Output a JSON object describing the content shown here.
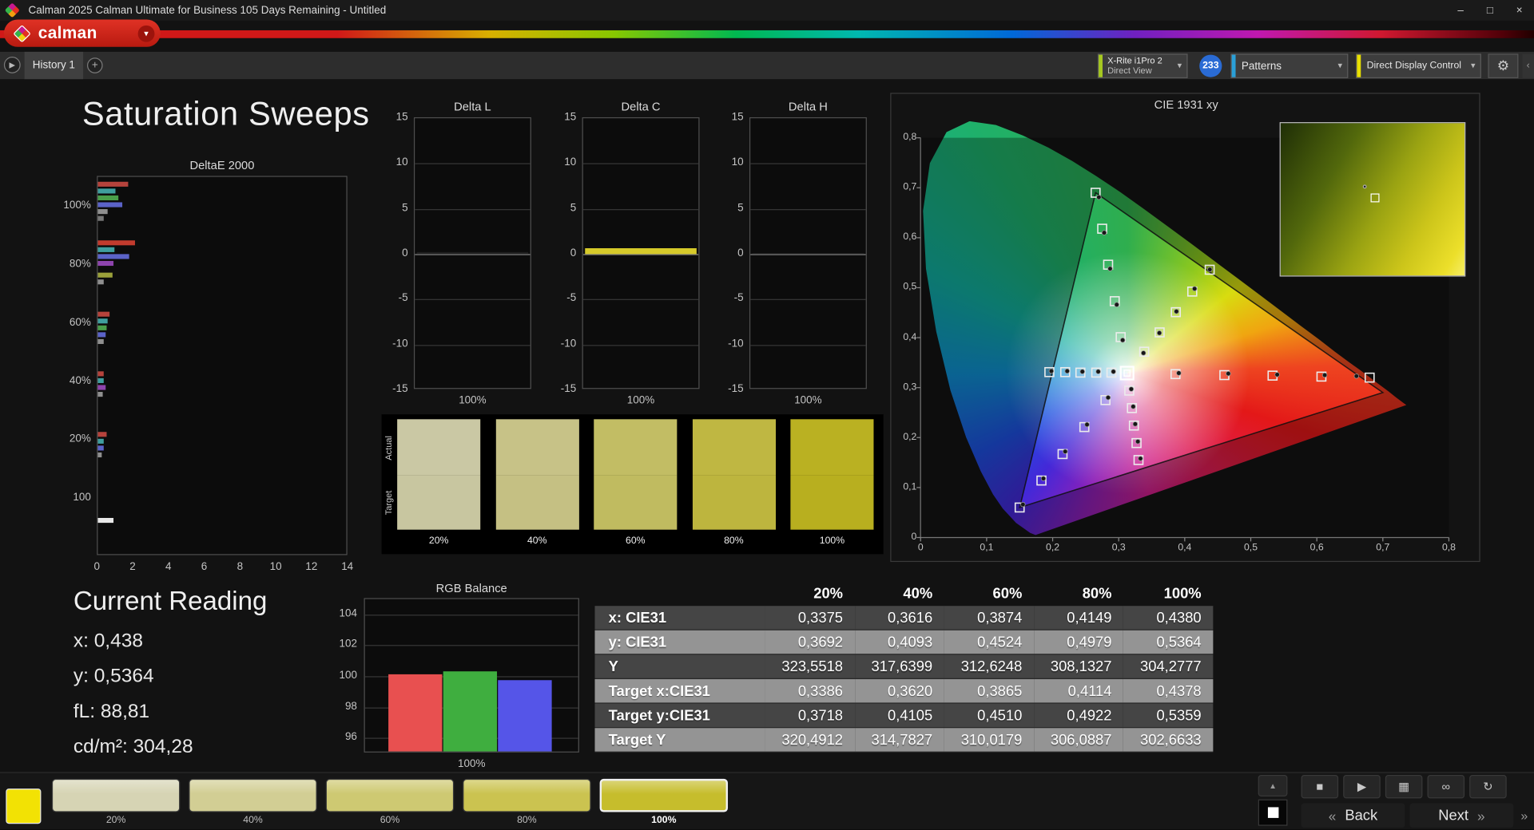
{
  "window": {
    "title": "Calman 2025 Calman Ultimate for Business 105 Days Remaining  - Untitled",
    "minimize_glyph": "–",
    "maximize_glyph": "□",
    "close_glyph": "×"
  },
  "brand": {
    "wordmark": "calman",
    "caret_glyph": "▾"
  },
  "nav": {
    "history_tab": "History 1",
    "add_tab_glyph": "+",
    "back_glyph": "▶"
  },
  "device_bar": {
    "meter_name": "X-Rite i1Pro 2",
    "meter_mode": "Direct View",
    "meter_accent": "#a6c821",
    "meter_badge": "233",
    "badge_color": "#2a6bd4",
    "patterns_label": "Patterns",
    "patterns_accent": "#2aa0d8",
    "display_control_label": "Direct Display Control",
    "display_accent": "#e8df00",
    "caret_glyph": "▾",
    "gear_glyph": "⚙",
    "edge_glyph": "‹"
  },
  "page": {
    "title": "Saturation Sweeps"
  },
  "current_reading": {
    "title": "Current Reading",
    "lines": [
      "x: 0,438",
      "y: 0,5364",
      "fL: 88,81",
      "cd/m²: 304,28"
    ]
  },
  "results_table": {
    "headers": [
      "20%",
      "40%",
      "60%",
      "80%",
      "100%"
    ],
    "rows": [
      {
        "label": "x: CIE31",
        "shade": "dark",
        "values": [
          "0,3375",
          "0,3616",
          "0,3874",
          "0,4149",
          "0,4380"
        ]
      },
      {
        "label": "y: CIE31",
        "shade": "light",
        "values": [
          "0,3692",
          "0,4093",
          "0,4524",
          "0,4979",
          "0,5364"
        ]
      },
      {
        "label": "Y",
        "shade": "dark",
        "values": [
          "323,5518",
          "317,6399",
          "312,6248",
          "308,1327",
          "304,2777"
        ]
      },
      {
        "label": "Target x:CIE31",
        "shade": "light",
        "values": [
          "0,3386",
          "0,3620",
          "0,3865",
          "0,4114",
          "0,4378"
        ]
      },
      {
        "label": "Target y:CIE31",
        "shade": "dark",
        "values": [
          "0,3718",
          "0,4105",
          "0,4510",
          "0,4922",
          "0,5359"
        ]
      },
      {
        "label": "Target Y",
        "shade": "light",
        "values": [
          "320,4912",
          "314,7827",
          "310,0179",
          "306,0887",
          "302,6633"
        ]
      }
    ]
  },
  "charts": {
    "delta_e": {
      "type": "bar",
      "title": "DeltaE 2000",
      "xlim": [
        0,
        14
      ],
      "x_ticks": [
        "0",
        "2",
        "4",
        "6",
        "8",
        "10",
        "12",
        "14"
      ],
      "y_labels": [
        "100%",
        "80%",
        "60%",
        "40%",
        "20%",
        "100"
      ],
      "y_label_fracs": [
        0.08,
        0.235,
        0.389,
        0.544,
        0.696,
        0.851
      ],
      "bars": [
        {
          "pos": 0.013,
          "val": 1.7,
          "color": "#b5433c"
        },
        {
          "pos": 0.031,
          "val": 1.0,
          "color": "#3f9e9e"
        },
        {
          "pos": 0.049,
          "val": 1.15,
          "color": "#4a9e4a"
        },
        {
          "pos": 0.067,
          "val": 1.35,
          "color": "#5b63c8"
        },
        {
          "pos": 0.085,
          "val": 0.55,
          "color": "#8f8f8f"
        },
        {
          "pos": 0.103,
          "val": 0.3,
          "color": "#777777"
        },
        {
          "pos": 0.168,
          "val": 2.1,
          "color": "#c23b2e"
        },
        {
          "pos": 0.186,
          "val": 0.9,
          "color": "#3f9e9e"
        },
        {
          "pos": 0.204,
          "val": 1.75,
          "color": "#5b63c8"
        },
        {
          "pos": 0.222,
          "val": 0.85,
          "color": "#8e44ad"
        },
        {
          "pos": 0.252,
          "val": 0.8,
          "color": "#9aa03a"
        },
        {
          "pos": 0.27,
          "val": 0.35,
          "color": "#8f8f8f"
        },
        {
          "pos": 0.355,
          "val": 0.65,
          "color": "#b5433c"
        },
        {
          "pos": 0.373,
          "val": 0.55,
          "color": "#3f9e9e"
        },
        {
          "pos": 0.391,
          "val": 0.5,
          "color": "#4a9e4a"
        },
        {
          "pos": 0.409,
          "val": 0.45,
          "color": "#5b63c8"
        },
        {
          "pos": 0.427,
          "val": 0.3,
          "color": "#8f8f8f"
        },
        {
          "pos": 0.512,
          "val": 0.35,
          "color": "#b5433c"
        },
        {
          "pos": 0.53,
          "val": 0.3,
          "color": "#3f9e9e"
        },
        {
          "pos": 0.548,
          "val": 0.45,
          "color": "#8e44ad"
        },
        {
          "pos": 0.566,
          "val": 0.25,
          "color": "#8f8f8f"
        },
        {
          "pos": 0.672,
          "val": 0.5,
          "color": "#b5433c"
        },
        {
          "pos": 0.69,
          "val": 0.3,
          "color": "#3f9e9e"
        },
        {
          "pos": 0.708,
          "val": 0.35,
          "color": "#5b63c8"
        },
        {
          "pos": 0.726,
          "val": 0.2,
          "color": "#8f8f8f"
        },
        {
          "pos": 0.9,
          "val": 0.85,
          "color": "#e8e8e8"
        }
      ]
    },
    "delta_l": {
      "type": "bar",
      "title": "Delta L",
      "ylim": [
        -15,
        15
      ],
      "y_ticks": [
        "15",
        "10",
        "5",
        "0",
        "-5",
        "-10",
        "-15"
      ],
      "xlabel": "100%",
      "value": 0.2,
      "bar_color": "#1f1f1f"
    },
    "delta_c": {
      "type": "bar",
      "title": "Delta C",
      "ylim": [
        -15,
        15
      ],
      "y_ticks": [
        "15",
        "10",
        "5",
        "0",
        "-5",
        "-10",
        "-15"
      ],
      "xlabel": "100%",
      "value": 0.6,
      "bar_color": "#d6ca2a"
    },
    "delta_h": {
      "type": "bar",
      "title": "Delta H",
      "ylim": [
        -15,
        15
      ],
      "y_ticks": [
        "15",
        "10",
        "5",
        "0",
        "-5",
        "-10",
        "-15"
      ],
      "xlabel": "100%",
      "value": 0.1,
      "bar_color": "#1f1f1f"
    },
    "swatch_strip": {
      "row_labels": [
        "Actual",
        "Target"
      ],
      "columns": [
        {
          "label": "20%",
          "actual": "#cac8a4",
          "target": "#c8c6a0"
        },
        {
          "label": "40%",
          "actual": "#c7c287",
          "target": "#c5c083"
        },
        {
          "label": "60%",
          "actual": "#c2bd64",
          "target": "#c0bb60"
        },
        {
          "label": "80%",
          "actual": "#bfb742",
          "target": "#bdb53e"
        },
        {
          "label": "100%",
          "actual": "#bab122",
          "target": "#b8af1f"
        }
      ]
    },
    "cie": {
      "type": "scatter",
      "title": "CIE 1931 xy",
      "x_ticks": [
        "0",
        "0,1",
        "0,2",
        "0,3",
        "0,4",
        "0,5",
        "0,6",
        "0,7",
        "0,8"
      ],
      "y_ticks": [
        "0",
        "0,1",
        "0,2",
        "0,3",
        "0,4",
        "0,5",
        "0,6",
        "0,7",
        "0,8"
      ],
      "xlim": [
        0,
        0.8
      ],
      "ylim": [
        0,
        0.8
      ],
      "white_point": [
        0.3127,
        0.329
      ],
      "triangle": [
        [
          0.7,
          0.29
        ],
        [
          0.265,
          0.69
        ],
        [
          0.15,
          0.06
        ]
      ],
      "sweeps": [
        {
          "name": "red",
          "targets": [
            [
              0.386,
              0.327
            ],
            [
              0.46,
              0.325
            ],
            [
              0.533,
              0.324
            ],
            [
              0.607,
              0.322
            ],
            [
              0.68,
              0.32
            ]
          ],
          "measured": [
            [
              0.391,
              0.329
            ],
            [
              0.466,
              0.328
            ],
            [
              0.54,
              0.326
            ],
            [
              0.612,
              0.325
            ],
            [
              0.66,
              0.323
            ]
          ]
        },
        {
          "name": "green",
          "targets": [
            [
              0.303,
              0.401
            ],
            [
              0.294,
              0.473
            ],
            [
              0.284,
              0.546
            ],
            [
              0.275,
              0.618
            ],
            [
              0.265,
              0.69
            ]
          ],
          "measured": [
            [
              0.306,
              0.395
            ],
            [
              0.297,
              0.466
            ],
            [
              0.287,
              0.538
            ],
            [
              0.278,
              0.61
            ],
            [
              0.27,
              0.681
            ]
          ]
        },
        {
          "name": "blue",
          "targets": [
            [
              0.28,
              0.275
            ],
            [
              0.248,
              0.221
            ],
            [
              0.215,
              0.167
            ],
            [
              0.183,
              0.114
            ],
            [
              0.15,
              0.06
            ]
          ],
          "measured": [
            [
              0.284,
              0.28
            ],
            [
              0.252,
              0.226
            ],
            [
              0.219,
              0.172
            ],
            [
              0.186,
              0.118
            ],
            [
              0.155,
              0.066
            ]
          ]
        },
        {
          "name": "yellow",
          "targets": [
            [
              0.3386,
              0.3718
            ],
            [
              0.362,
              0.4105
            ],
            [
              0.3865,
              0.451
            ],
            [
              0.4114,
              0.4922
            ],
            [
              0.4378,
              0.5359
            ]
          ],
          "measured": [
            [
              0.3375,
              0.3692
            ],
            [
              0.3616,
              0.4093
            ],
            [
              0.3874,
              0.4524
            ],
            [
              0.4149,
              0.4979
            ],
            [
              0.438,
              0.5364
            ]
          ]
        },
        {
          "name": "cyan",
          "targets": [
            [
              0.289,
              0.33
            ],
            [
              0.266,
              0.33
            ],
            [
              0.242,
              0.33
            ],
            [
              0.219,
              0.331
            ],
            [
              0.195,
              0.331
            ]
          ],
          "measured": [
            [
              0.292,
              0.332
            ],
            [
              0.269,
              0.332
            ],
            [
              0.245,
              0.332
            ],
            [
              0.222,
              0.333
            ],
            [
              0.198,
              0.333
            ]
          ]
        },
        {
          "name": "magenta",
          "targets": [
            [
              0.316,
              0.294
            ],
            [
              0.32,
              0.259
            ],
            [
              0.323,
              0.224
            ],
            [
              0.327,
              0.189
            ],
            [
              0.33,
              0.155
            ]
          ],
          "measured": [
            [
              0.319,
              0.297
            ],
            [
              0.322,
              0.262
            ],
            [
              0.325,
              0.227
            ],
            [
              0.329,
              0.192
            ],
            [
              0.333,
              0.158
            ]
          ]
        }
      ]
    },
    "rgb_balance": {
      "type": "bar",
      "title": "RGB Balance",
      "ylim": [
        95,
        105
      ],
      "y_ticks": [
        "104",
        "102",
        "100",
        "98",
        "96"
      ],
      "xlabel": "100%",
      "series": [
        {
          "name": "red",
          "value": 100.0,
          "color": "#e85050"
        },
        {
          "name": "green",
          "value": 100.2,
          "color": "#3fae3f"
        },
        {
          "name": "blue",
          "value": 99.6,
          "color": "#5555e8"
        }
      ]
    }
  },
  "bottom_bar": {
    "patch_color": "#f2e204",
    "swatches": [
      {
        "label": "20%",
        "color": "#d6d4b4",
        "selected": false
      },
      {
        "label": "40%",
        "color": "#d2ce94",
        "selected": false
      },
      {
        "label": "60%",
        "color": "#cec972",
        "selected": false
      },
      {
        "label": "80%",
        "color": "#cbc350",
        "selected": false
      },
      {
        "label": "100%",
        "color": "#c6bd2c",
        "selected": true
      }
    ],
    "transport": [
      {
        "name": "stop-icon",
        "glyph": "■"
      },
      {
        "name": "play-icon",
        "glyph": "▶"
      },
      {
        "name": "save-icon",
        "glyph": "▦"
      },
      {
        "name": "link-icon",
        "glyph": "∞"
      },
      {
        "name": "refresh-icon",
        "glyph": "↻"
      }
    ],
    "collapse_glyph": "▲",
    "back_chevron": "«",
    "back_label": "Back",
    "next_label": "Next",
    "next_chevron": "»",
    "corner_chevron": "»"
  }
}
